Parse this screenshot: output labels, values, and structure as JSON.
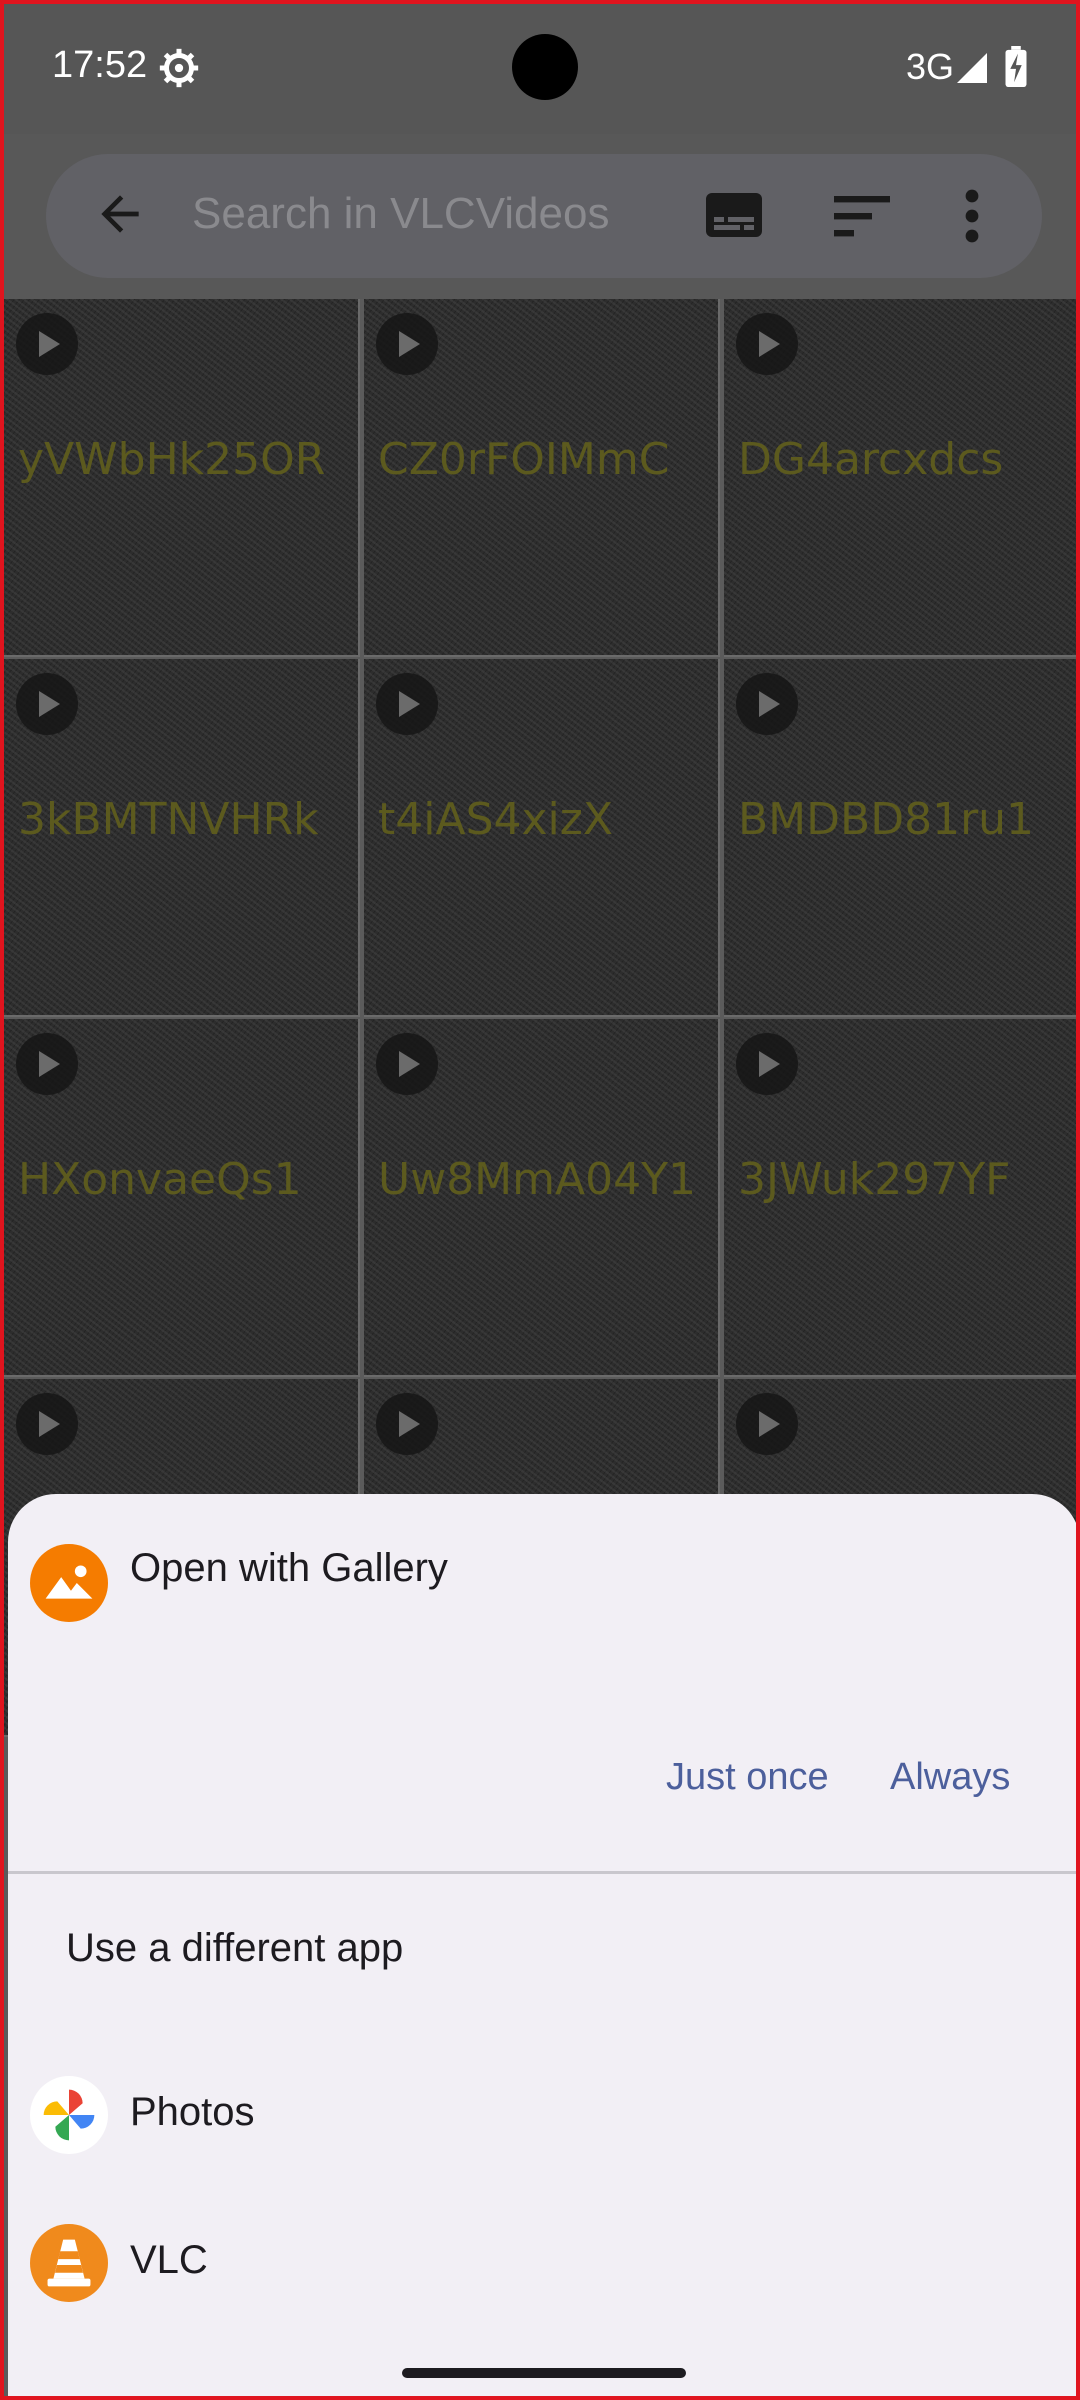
{
  "status_bar": {
    "time": "17:52",
    "network": "3G"
  },
  "search": {
    "placeholder": "Search in VLCVideos"
  },
  "videos": [
    "yVWbHk25OR",
    "CZ0rFOIMmC",
    "DG4arcxdcs",
    "3kBMTNVHRk",
    "t4iAS4xizX",
    "BMDBD81ru1",
    "HXonvaeQs1",
    "Uw8MmA04Y1",
    "3JWuk297YF",
    "",
    "",
    ""
  ],
  "sheet": {
    "open_with": "Open with Gallery",
    "just_once": "Just once",
    "always": "Always",
    "different_app": "Use a different app",
    "apps": [
      "Photos",
      "VLC"
    ]
  },
  "colors": {
    "accent": "#4c5f9c",
    "gallery_orange": "#f57c00",
    "vlc_orange": "#f08a1c"
  }
}
